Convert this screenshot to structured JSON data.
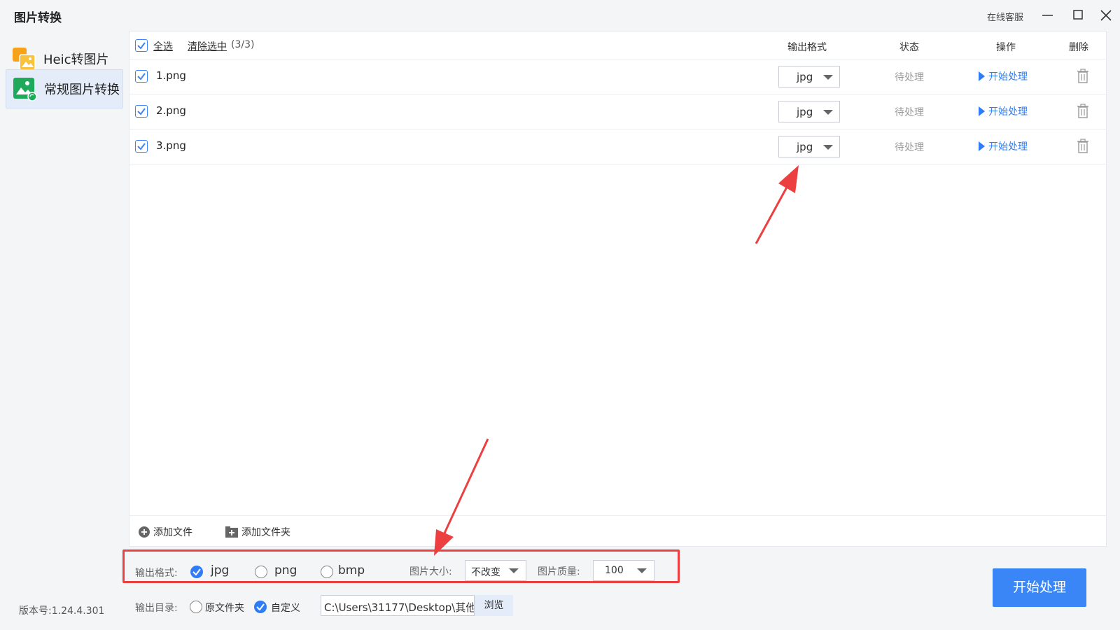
{
  "window": {
    "title": "图片转换",
    "support_label": "在线客服"
  },
  "sidebar": {
    "items": [
      {
        "label": "Heic转图片",
        "active": false
      },
      {
        "label": "常规图片转换",
        "active": true
      }
    ],
    "version": "版本号:1.24.4.301"
  },
  "file_list": {
    "select_all_label": "全选",
    "clear_selection_label": "清除选中",
    "clear_selection_count": "(3/3)",
    "columns": {
      "output_format": "输出格式",
      "status": "状态",
      "operation": "操作",
      "delete": "删除"
    },
    "rows": [
      {
        "name": "1.png",
        "checked": true,
        "format": "jpg",
        "status": "待处理",
        "action": "开始处理"
      },
      {
        "name": "2.png",
        "checked": true,
        "format": "jpg",
        "status": "待处理",
        "action": "开始处理"
      },
      {
        "name": "3.png",
        "checked": true,
        "format": "jpg",
        "status": "待处理",
        "action": "开始处理"
      }
    ],
    "add_file_label": "添加文件",
    "add_folder_label": "添加文件夹"
  },
  "settings": {
    "output_format_label": "输出格式:",
    "formats": [
      {
        "label": "jpg",
        "selected": true
      },
      {
        "label": "png",
        "selected": false
      },
      {
        "label": "bmp",
        "selected": false
      }
    ],
    "image_size_label": "图片大小:",
    "image_size_value": "不改变",
    "image_quality_label": "图片质量:",
    "image_quality_value": "100",
    "output_dir_label": "输出目录:",
    "dir_options": [
      {
        "label": "原文件夹",
        "selected": false
      },
      {
        "label": "自定义",
        "selected": true
      }
    ],
    "output_path": "C:\\Users\\31177\\Desktop\\其他",
    "browse_label": "浏览",
    "start_button_label": "开始处理"
  },
  "colors": {
    "accent": "#3a86f7",
    "annotation": "#ec4040",
    "status_text": "#999999"
  }
}
